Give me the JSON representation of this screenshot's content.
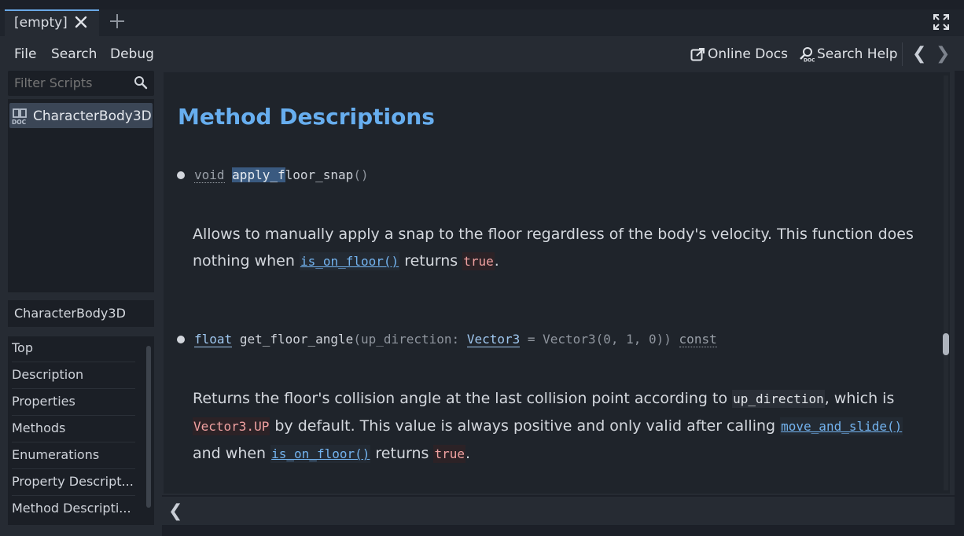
{
  "tab": {
    "label": "[empty]"
  },
  "menu": {
    "file": "File",
    "search": "Search",
    "debug": "Debug"
  },
  "toolbar": {
    "online_docs": "Online Docs",
    "search_help": "Search Help"
  },
  "filter": {
    "placeholder": "Filter Scripts"
  },
  "scripts": [
    {
      "label": "CharacterBody3D"
    }
  ],
  "class_name": "CharacterBody3D",
  "toc": [
    {
      "label": "Top"
    },
    {
      "label": "Description"
    },
    {
      "label": "Properties"
    },
    {
      "label": "Methods"
    },
    {
      "label": "Enumerations"
    },
    {
      "label": "Property Descript..."
    },
    {
      "label": "Method Descripti..."
    }
  ],
  "doc": {
    "heading": "Method Descriptions",
    "m1": {
      "ret": "void",
      "name_selected": "apply_f",
      "name_rest": "loor_snap",
      "parens": "()",
      "desc_1": "Allows to manually apply a snap to the floor regardless of the body's velocity. This function does",
      "desc_2a": "nothing when ",
      "link": "is_on_floor()",
      "desc_2b": " returns ",
      "code_true": "true",
      "desc_2c": "."
    },
    "m2": {
      "ret": "float",
      "name": "get_floor_angle",
      "open": "(up_direction: ",
      "param_type": "Vector3",
      "default": " = Vector3(0, 1, 0))",
      "qual": "const",
      "d1a": "Returns the floor's collision angle at the last collision point according to ",
      "code_up": "up_direction",
      "d1b": ", which is",
      "code_vec": "Vector3.UP",
      "d2a": " by default. This value is always positive and only valid after calling ",
      "link_move": "move_and_slide()",
      "d3a": "and when ",
      "link_floor": "is_on_floor()",
      "d3b": " returns ",
      "code_true": "true",
      "d3c": "."
    }
  },
  "colors": {
    "accent": "#67aeef",
    "link": "#73b3ef",
    "selection": "#3a5a80"
  }
}
